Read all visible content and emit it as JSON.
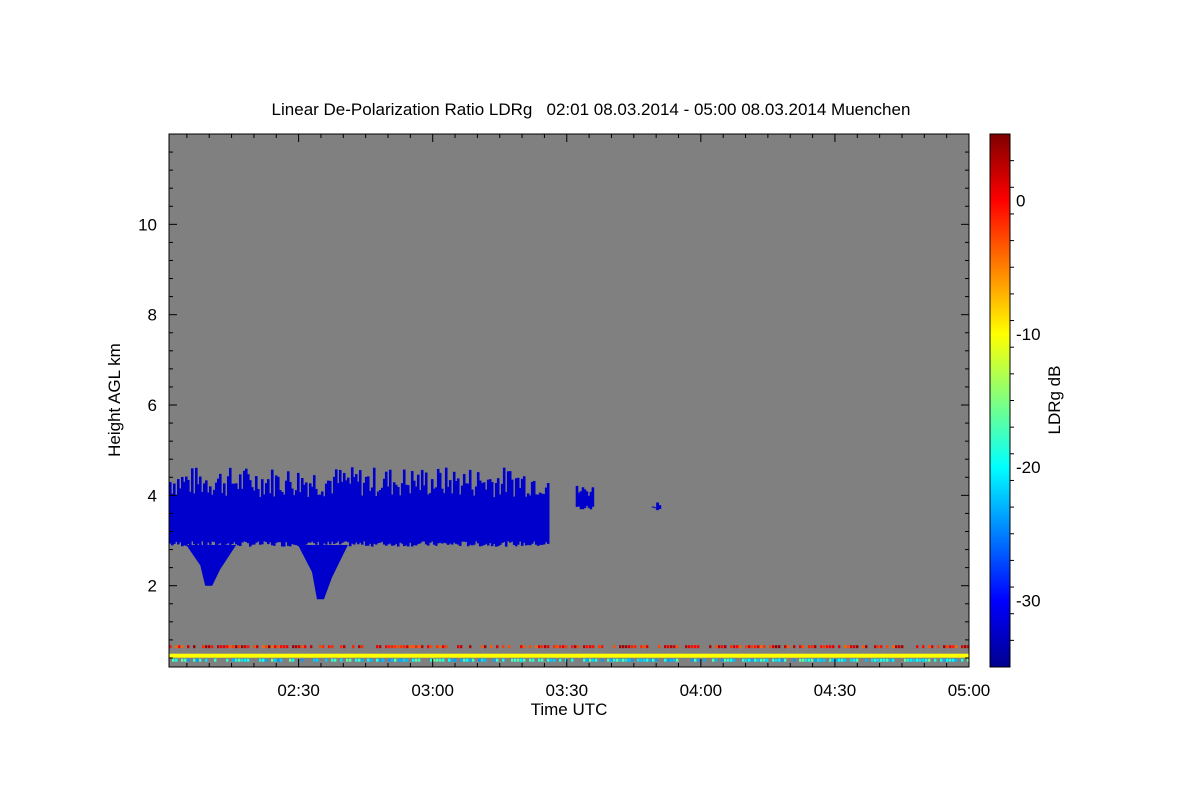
{
  "chart_data": {
    "type": "heatmap",
    "title": "Linear De-Polarization Ratio LDRg   02:01 08.03.2014 - 05:00 08.03.2014 Muenchen",
    "xlabel": "Time UTC",
    "ylabel": "Height AGL km",
    "colorbar_label": "LDRg dB",
    "xlim": [
      "02:01",
      "05:00"
    ],
    "ylim": [
      0.2,
      12
    ],
    "zlim": [
      -35,
      5
    ],
    "x_ticks": [
      "02:30",
      "03:00",
      "03:30",
      "04:00",
      "04:30",
      "05:00"
    ],
    "y_ticks": [
      2,
      4,
      6,
      8,
      10
    ],
    "colorbar_ticks": [
      0,
      -10,
      -20,
      -30
    ],
    "colormap": "jet",
    "background_color": "#808080",
    "features": [
      {
        "name": "cloud layer",
        "t_start": "02:01",
        "t_end": "03:26",
        "base_km": 2.9,
        "top_km": 4.3,
        "ldr_db": -32
      },
      {
        "name": "virga",
        "t_start": "02:08",
        "t_end": "02:12",
        "bottom_km": 2.0,
        "ldr_db": -32
      },
      {
        "name": "virga",
        "t_start": "02:33",
        "t_end": "02:37",
        "bottom_km": 1.7,
        "ldr_db": -32
      },
      {
        "name": "cloud fragment",
        "t_start": "03:32",
        "t_end": "03:36",
        "base_km": 3.7,
        "top_km": 4.1,
        "ldr_db": -32
      },
      {
        "name": "cloud fragment",
        "t_start": "03:49",
        "t_end": "03:51",
        "base_km": 3.7,
        "top_km": 3.8,
        "ldr_db": -32
      },
      {
        "name": "near-ground band",
        "height_km": 0.65,
        "ldr_db": 0
      },
      {
        "name": "near-ground band",
        "height_km": 0.45,
        "ldr_db": -10
      },
      {
        "name": "near-ground band",
        "height_km": 0.35,
        "ldr_db": -20
      }
    ]
  }
}
